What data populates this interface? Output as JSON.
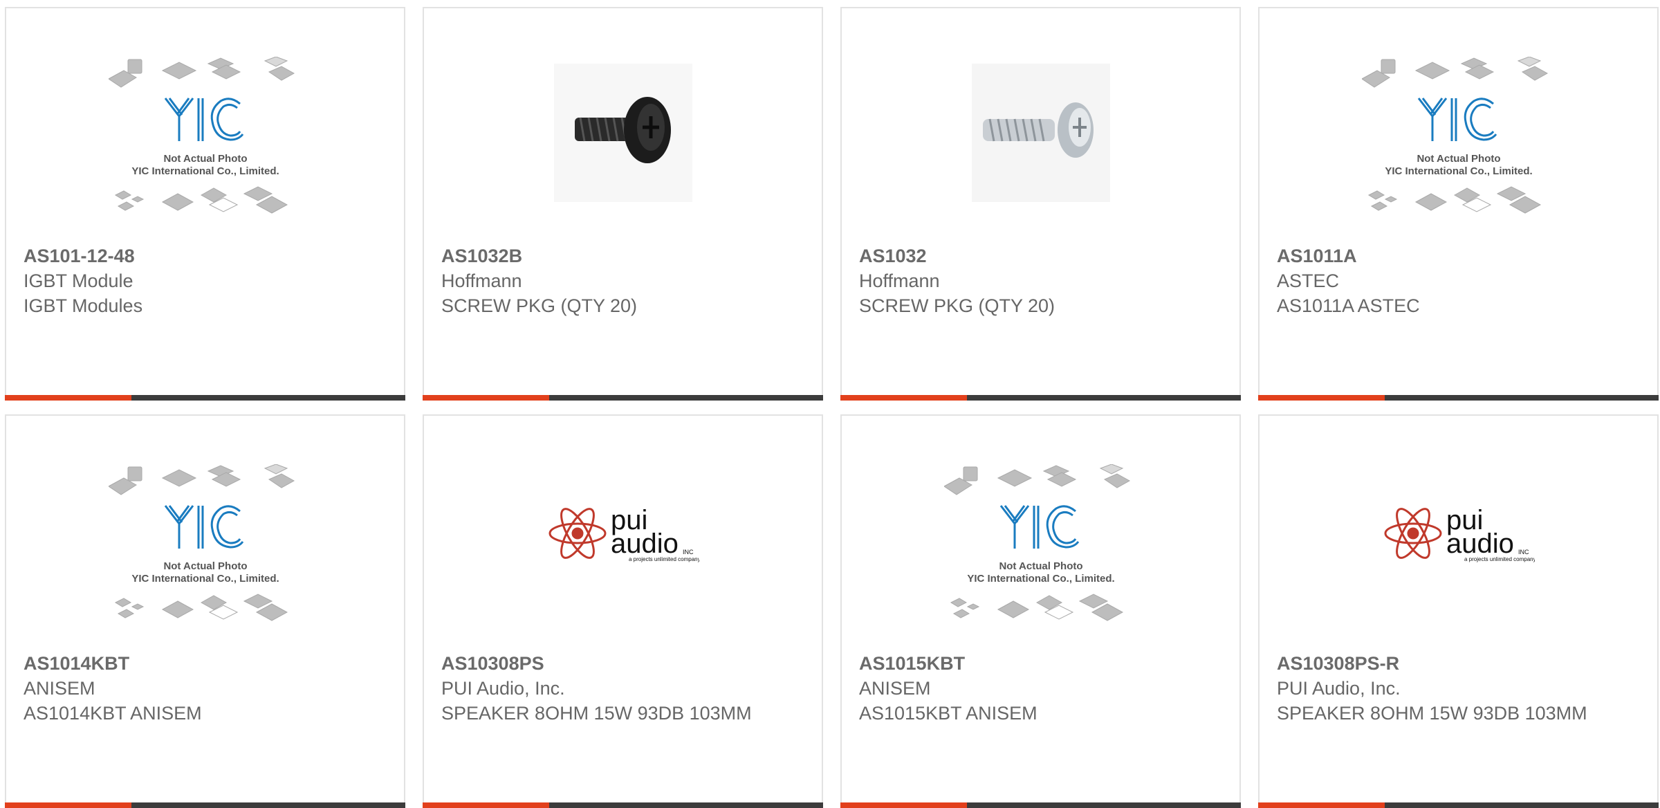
{
  "products": [
    {
      "part": "AS101-12-48",
      "manufacturer": "IGBT Module",
      "description": "IGBT Modules",
      "image": "yic",
      "image_caption_1": "Not Actual Photo",
      "image_caption_2": "YIC International Co., Limited.",
      "image_logo": "YIC"
    },
    {
      "part": "AS1032B",
      "manufacturer": "Hoffmann",
      "description": "SCREW PKG (QTY 20)",
      "image": "screw-black"
    },
    {
      "part": "AS1032",
      "manufacturer": "Hoffmann",
      "description": "SCREW PKG (QTY 20)",
      "image": "screw-silver"
    },
    {
      "part": "AS1011A",
      "manufacturer": "ASTEC",
      "description": "AS1011A ASTEC",
      "image": "yic",
      "image_caption_1": "Not Actual Photo",
      "image_caption_2": "YIC International Co., Limited.",
      "image_logo": "YIC"
    },
    {
      "part": "AS1014KBT",
      "manufacturer": "ANISEM",
      "description": "AS1014KBT ANISEM",
      "image": "yic",
      "image_caption_1": "Not Actual Photo",
      "image_caption_2": "YIC International Co., Limited.",
      "image_logo": "YIC"
    },
    {
      "part": "AS10308PS",
      "manufacturer": "PUI Audio, Inc.",
      "description": "SPEAKER 8OHM 15W 93DB 103MM",
      "image": "pui",
      "logo_line_1": "pui",
      "logo_line_2": "audio",
      "logo_inc": "INC",
      "logo_tagline": "a projects unlimited company"
    },
    {
      "part": "AS1015KBT",
      "manufacturer": "ANISEM",
      "description": "AS1015KBT ANISEM",
      "image": "yic",
      "image_caption_1": "Not Actual Photo",
      "image_caption_2": "YIC International Co., Limited.",
      "image_logo": "YIC"
    },
    {
      "part": "AS10308PS-R",
      "manufacturer": "PUI Audio, Inc.",
      "description": "SPEAKER 8OHM 15W 93DB 103MM",
      "image": "pui",
      "logo_line_1": "pui",
      "logo_line_2": "audio",
      "logo_inc": "INC",
      "logo_tagline": "a projects unlimited company"
    }
  ],
  "colors": {
    "accent_bar": "#e2401c",
    "dark_bar": "#3c3c3c",
    "text": "#666666",
    "yic_blue": "#1a7cc0",
    "pui_red": "#c0392b"
  }
}
